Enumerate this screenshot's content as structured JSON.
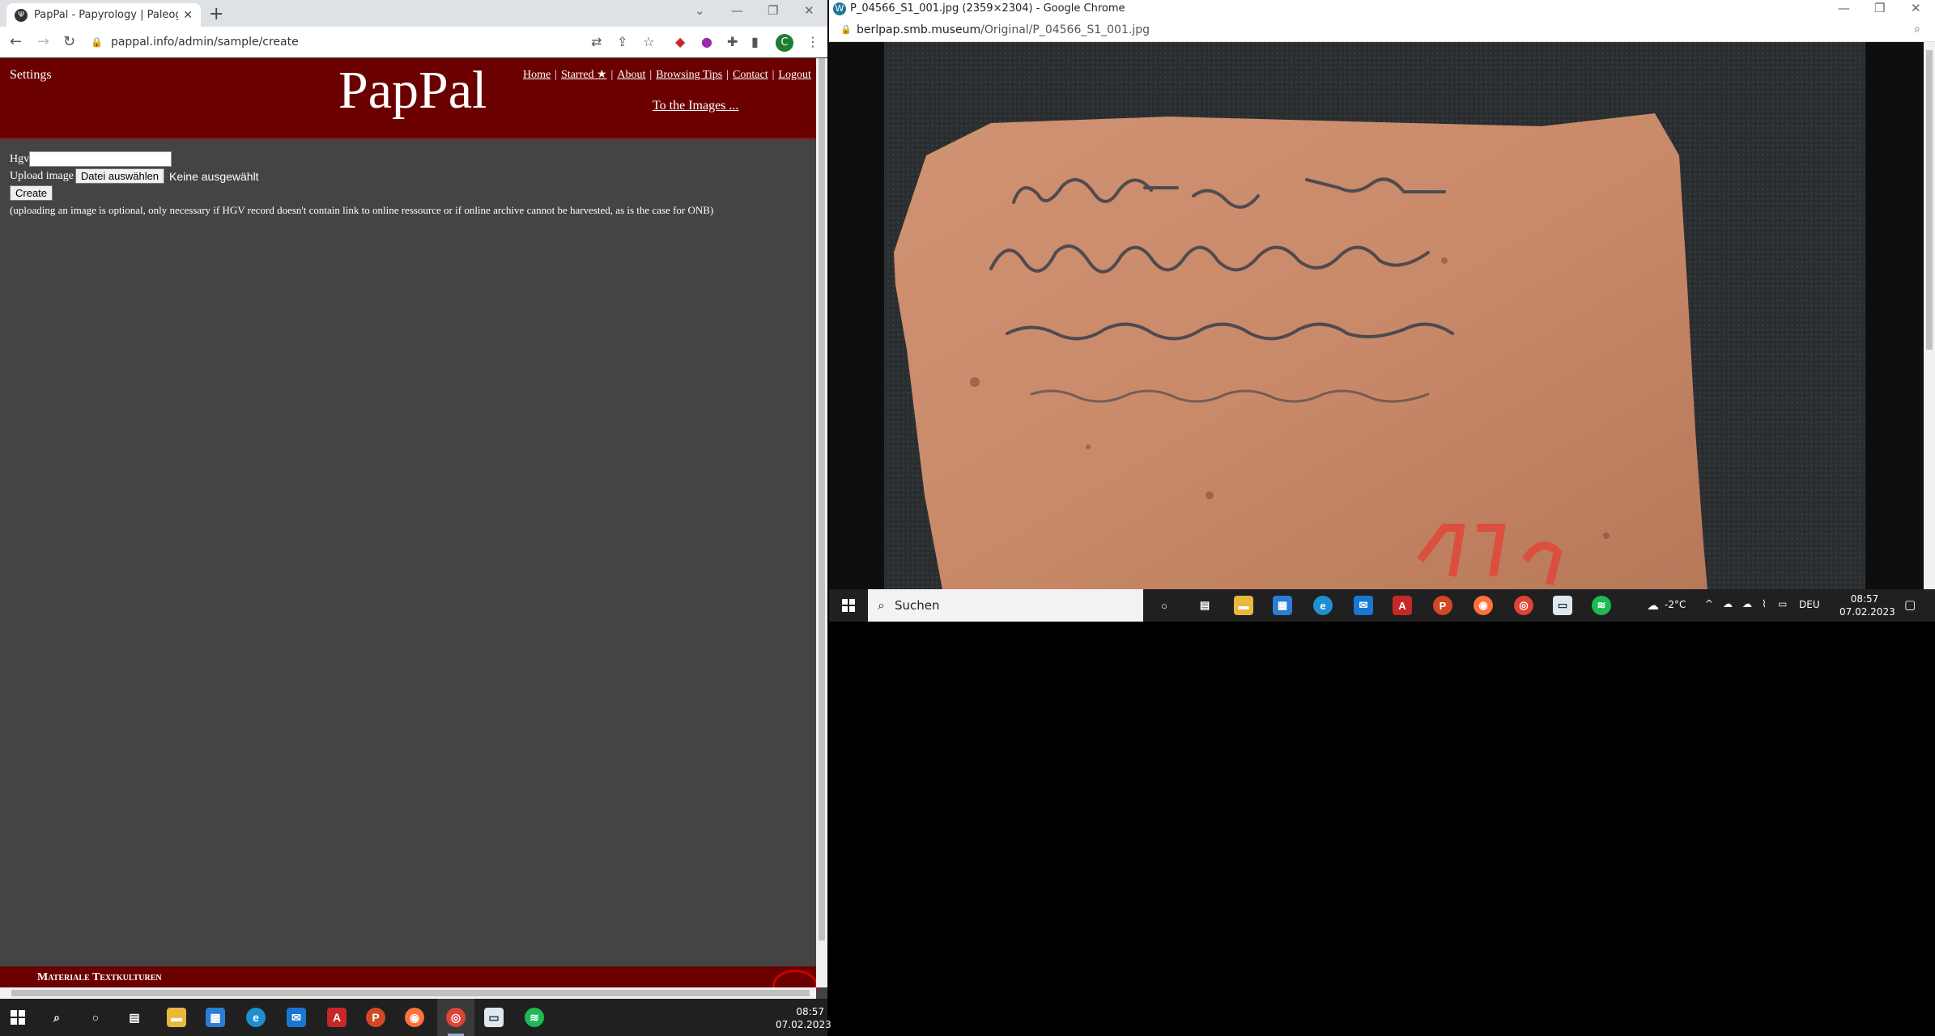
{
  "left_browser": {
    "tab_title": "PapPal - Papyrology | Paleograph",
    "tab_favicon": "pappal-favicon-icon",
    "new_tab_label": "+",
    "url": "pappal.info/admin/sample/create",
    "profile_initial": "C"
  },
  "pappal": {
    "settings_label": "Settings",
    "logo": "PapPal",
    "nav": [
      {
        "label": "Home"
      },
      {
        "label": "Starred ★"
      },
      {
        "label": "About"
      },
      {
        "label": "Browsing Tips"
      },
      {
        "label": "Contact"
      },
      {
        "label": "Logout"
      }
    ],
    "nav_separator": "|",
    "to_images_link": "To the Images ...",
    "form": {
      "hgv_label": "Hgv",
      "hgv_value": "",
      "upload_label": "Upload image",
      "file_button": "Datei auswählen",
      "file_status": "Keine ausgewählt",
      "create_button": "Create",
      "note": "(uploading an image is optional, only necessary if HGV record doesn't contain link to online ressource or if online archive cannot be harvested, as is the case for ONB)"
    },
    "footer_text": "Materiale Textkulturen"
  },
  "taskbar_left": {
    "time": "08:57",
    "date": "07.02.2023",
    "apps": [
      "windows-start",
      "search",
      "cortana",
      "task-view",
      "file-explorer",
      "store",
      "edge",
      "mail",
      "acrobat",
      "powerpoint",
      "firefox",
      "chrome",
      "notepad",
      "spotify"
    ]
  },
  "right_browser": {
    "window_title": "P_04566_S1_001.jpg (2359×2304) - Google Chrome",
    "url_domain": "berlpap.smb.museum",
    "url_path": "/Original/P_04566_S1_001.jpg"
  },
  "taskbar_right": {
    "search_placeholder": "Suchen",
    "weather": "-2°C",
    "language": "DEU",
    "time": "08:57",
    "date": "07.02.2023"
  },
  "colors": {
    "pappal_red": "#6b0000",
    "page_bg": "#444444",
    "taskbar": "#202020",
    "ostracon": "#c98a6a",
    "ink": "#3a3f4a"
  }
}
